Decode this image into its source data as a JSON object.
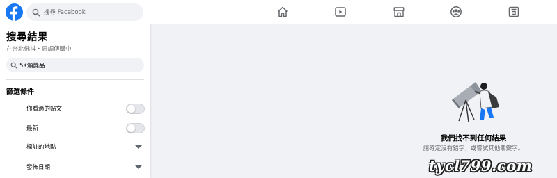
{
  "header": {
    "search_placeholder": "搜尋 Facebook",
    "brand_color": "#1877f2",
    "nav_icons": [
      "home-icon",
      "watch-icon",
      "marketplace-icon",
      "groups-icon",
      "gaming-icon"
    ]
  },
  "sidebar": {
    "title": "搜尋結果",
    "subtitle": "在奈北佛抖・忠調傳購中",
    "query_value": "5K頒獎品",
    "filter_title": "篩選條件",
    "filters": [
      {
        "label": "你看過的貼文",
        "control": "toggle",
        "on": false
      },
      {
        "label": "最新",
        "control": "toggle",
        "on": false
      },
      {
        "label": "標註的地點",
        "control": "dropdown"
      },
      {
        "label": "發佈日期",
        "control": "dropdown"
      }
    ]
  },
  "main": {
    "empty_title": "我們找不到任何結果",
    "empty_subtitle": "請確定沒有錯字，或嘗試其他關鍵字。"
  },
  "watermark": "tycl799.com"
}
